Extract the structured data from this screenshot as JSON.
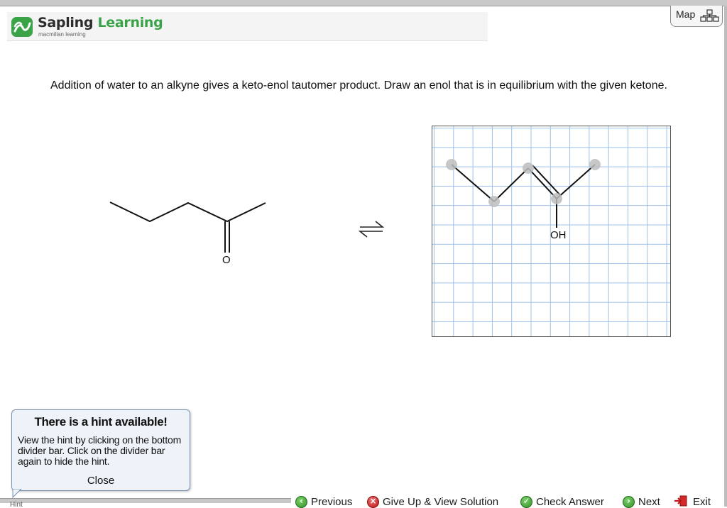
{
  "app": {
    "brand_name_part1": "Sapling",
    "brand_name_part2": "Learning",
    "brand_subtitle": "macmillan learning",
    "brand_color": "#3aa348"
  },
  "header": {
    "map_label": "Map",
    "map_icon": "sitemap-icon"
  },
  "question": {
    "text": "Addition of water to an alkyne gives a keto-enol tautomer product. Draw an enol that is in equilibrium with the given ketone."
  },
  "given_molecule": {
    "oxygen_label": "O"
  },
  "equilibrium": {
    "icon": "equilibrium-arrows-icon"
  },
  "drawing_canvas": {
    "oh_label": "OH",
    "grid_color": "#9ec1e8",
    "atom_color": "#bdbdbd"
  },
  "hint": {
    "title": "There is a hint available!",
    "body": "View the hint by clicking on the bottom divider bar. Click on the divider bar again to hide the hint.",
    "close_label": "Close",
    "tab_label": "Hint"
  },
  "navigation": {
    "previous_label": "Previous",
    "give_up_label": "Give Up & View Solution",
    "check_answer_label": "Check Answer",
    "next_label": "Next",
    "exit_label": "Exit"
  }
}
